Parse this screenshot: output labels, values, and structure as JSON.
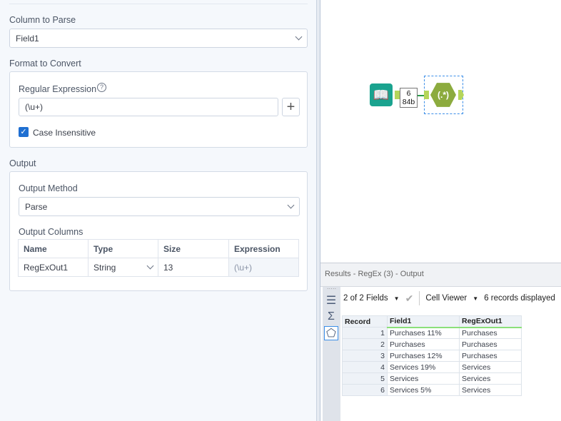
{
  "config": {
    "column_to_parse_label": "Column to Parse",
    "column_to_parse_value": "Field1",
    "format_label": "Format to Convert",
    "regex_label": "Regular Expression",
    "regex_value": "(\\u+)",
    "case_insensitive_label": "Case Insensitive",
    "case_insensitive_checked": true,
    "output_label": "Output",
    "output_method_label": "Output Method",
    "output_method_value": "Parse",
    "output_columns_label": "Output Columns",
    "columns_headers": [
      "Name",
      "Type",
      "Size",
      "Expression"
    ],
    "columns_rows": [
      {
        "name": "RegExOut1",
        "type": "String",
        "size": "13",
        "expression": "(\\u+)"
      }
    ]
  },
  "canvas": {
    "connection_records": "6",
    "connection_size": "84b",
    "regex_tool_glyph": "(.*)"
  },
  "results": {
    "title": "Results - RegEx (3) - Output",
    "fields_label": "2 of 2 Fields",
    "viewer_label": "Cell Viewer",
    "records_label": "6 records displayed",
    "headers": [
      "Record",
      "Field1",
      "RegExOut1"
    ],
    "rows": [
      [
        "1",
        "Purchases 11%",
        "Purchases"
      ],
      [
        "2",
        "Purchases",
        "Purchases"
      ],
      [
        "3",
        "Purchases 12%",
        "Purchases"
      ],
      [
        "4",
        "Services 19%",
        "Services"
      ],
      [
        "5",
        "Services",
        "Services"
      ],
      [
        "6",
        "Services 5%",
        "Services"
      ]
    ]
  }
}
